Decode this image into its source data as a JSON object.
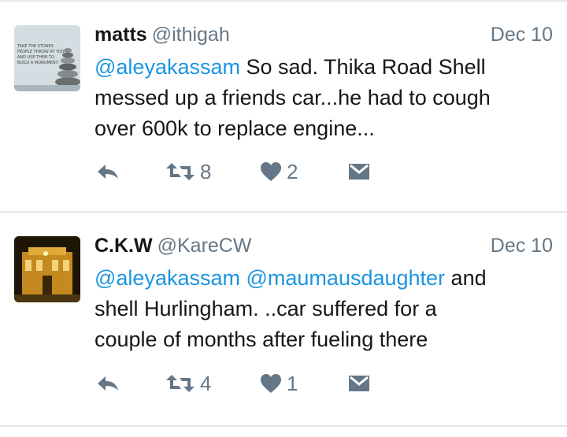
{
  "tweets": [
    {
      "name": "matts",
      "handle": "@ithigah",
      "date": "Dec 10",
      "lines": [
        [
          {
            "t": "@aleyakassam",
            "m": true
          },
          {
            "t": " So sad. Thika Road Shell",
            "m": false
          }
        ],
        [
          {
            "t": "messed up a friends car...he had to cough",
            "m": false
          }
        ],
        [
          {
            "t": "over 600k to replace engine...",
            "m": false
          }
        ]
      ],
      "retweets": "8",
      "likes": "2",
      "avatar_text": [
        "TAKE THE STONES",
        "PEOPLE THROW AT YOU",
        "AND USE THEM TO",
        "BUILD A MONUMENT."
      ]
    },
    {
      "name": "C.K.W",
      "handle": "@KareCW",
      "date": "Dec 10",
      "lines": [
        [
          {
            "t": "@aleyakassam",
            "m": true
          },
          {
            "t": " ",
            "m": false
          },
          {
            "t": "@maumausdaughter",
            "m": true
          },
          {
            "t": " and",
            "m": false
          }
        ],
        [
          {
            "t": "shell Hurlingham. ..car suffered for a",
            "m": false
          }
        ],
        [
          {
            "t": "couple of months after fueling there",
            "m": false
          }
        ]
      ],
      "retweets": "4",
      "likes": "1"
    }
  ],
  "icons": {
    "reply": "reply-icon",
    "retweet": "retweet-icon",
    "like": "heart-icon",
    "message": "direct-message-icon"
  },
  "colors": {
    "text": "#14171a",
    "secondary": "#657786",
    "mention": "#1b95e0",
    "divider": "#e1e8ed"
  }
}
